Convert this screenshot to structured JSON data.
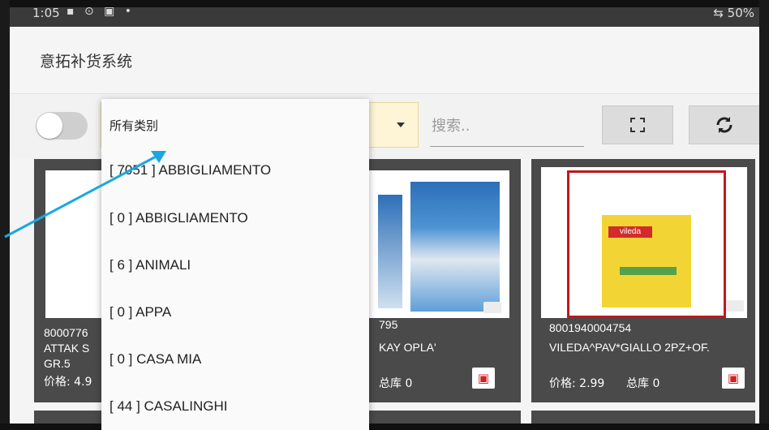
{
  "statusbar": {
    "time": "1:05",
    "icons": "▪ ⊙ ▣ •",
    "battery": "⇆ 50%"
  },
  "app": {
    "title": "意拓补货系统"
  },
  "toolbar": {
    "category_selected": "所有类别",
    "search_placeholder": "搜索..",
    "scan_icon": "scan-frame-icon",
    "refresh_icon": "refresh-icon"
  },
  "dropdown": {
    "items": [
      "所有类别",
      "[ 7051 ] ABBIGLIAMENTO",
      "[ 0 ] ABBIGLIAMENTO",
      "[ 6 ] ANIMALI",
      "[ 0 ] APPA",
      "[ 0 ] CASA MIA",
      "[ 44 ] CASALINGHI"
    ]
  },
  "products": [
    {
      "code": "8000776",
      "name_line1": "ATTAK S",
      "name_line2": "GR.5",
      "price": "价格: 4.9",
      "stock": ""
    },
    {
      "code": "795",
      "name_line1": "KAY OPLA'",
      "name_line2": "",
      "price": "",
      "stock": "总库  0"
    },
    {
      "code": "8001940004754",
      "name_line1": "VILEDA^PAV*GIALLO 2PZ+OF.",
      "name_line2": "",
      "price": "价格: 2.99",
      "stock": "总库  0",
      "image_brand": "vileda"
    }
  ],
  "colors": {
    "accent_red": "#d62020",
    "card_bg": "#4a4a4a",
    "select_bg": "#fdf5d6",
    "arrow": "#1aa7e0"
  }
}
